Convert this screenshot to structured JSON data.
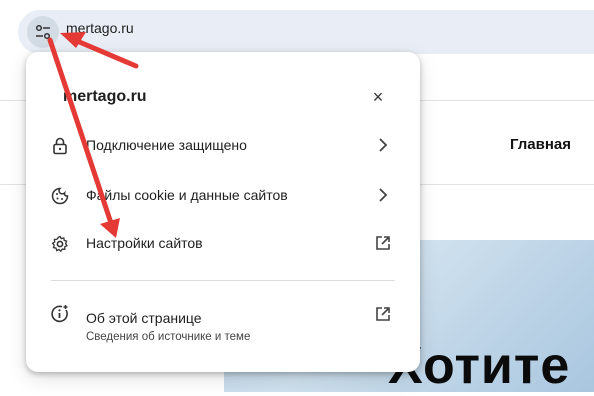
{
  "addressbar": {
    "url": "mertago.ru"
  },
  "page": {
    "nav_home": "Главная",
    "hero_text": "Хотите"
  },
  "popup": {
    "title": "mertago.ru",
    "close": "×",
    "items": [
      {
        "label": "Подключение защищено",
        "icon": "lock-icon",
        "trailing": "chevron-right-icon"
      },
      {
        "label": "Файлы cookie и данные сайтов",
        "icon": "cookie-icon",
        "trailing": "chevron-right-icon"
      },
      {
        "label": "Настройки сайтов",
        "icon": "gear-icon",
        "trailing": "external-link-icon"
      },
      {
        "label": "Об этой странице",
        "sublabel": "Сведения об источнике и теме",
        "icon": "page-info-icon",
        "trailing": "external-link-icon"
      }
    ]
  },
  "colors": {
    "annotation_arrow": "#e53935",
    "addressbar_bg": "#e9eef6"
  }
}
